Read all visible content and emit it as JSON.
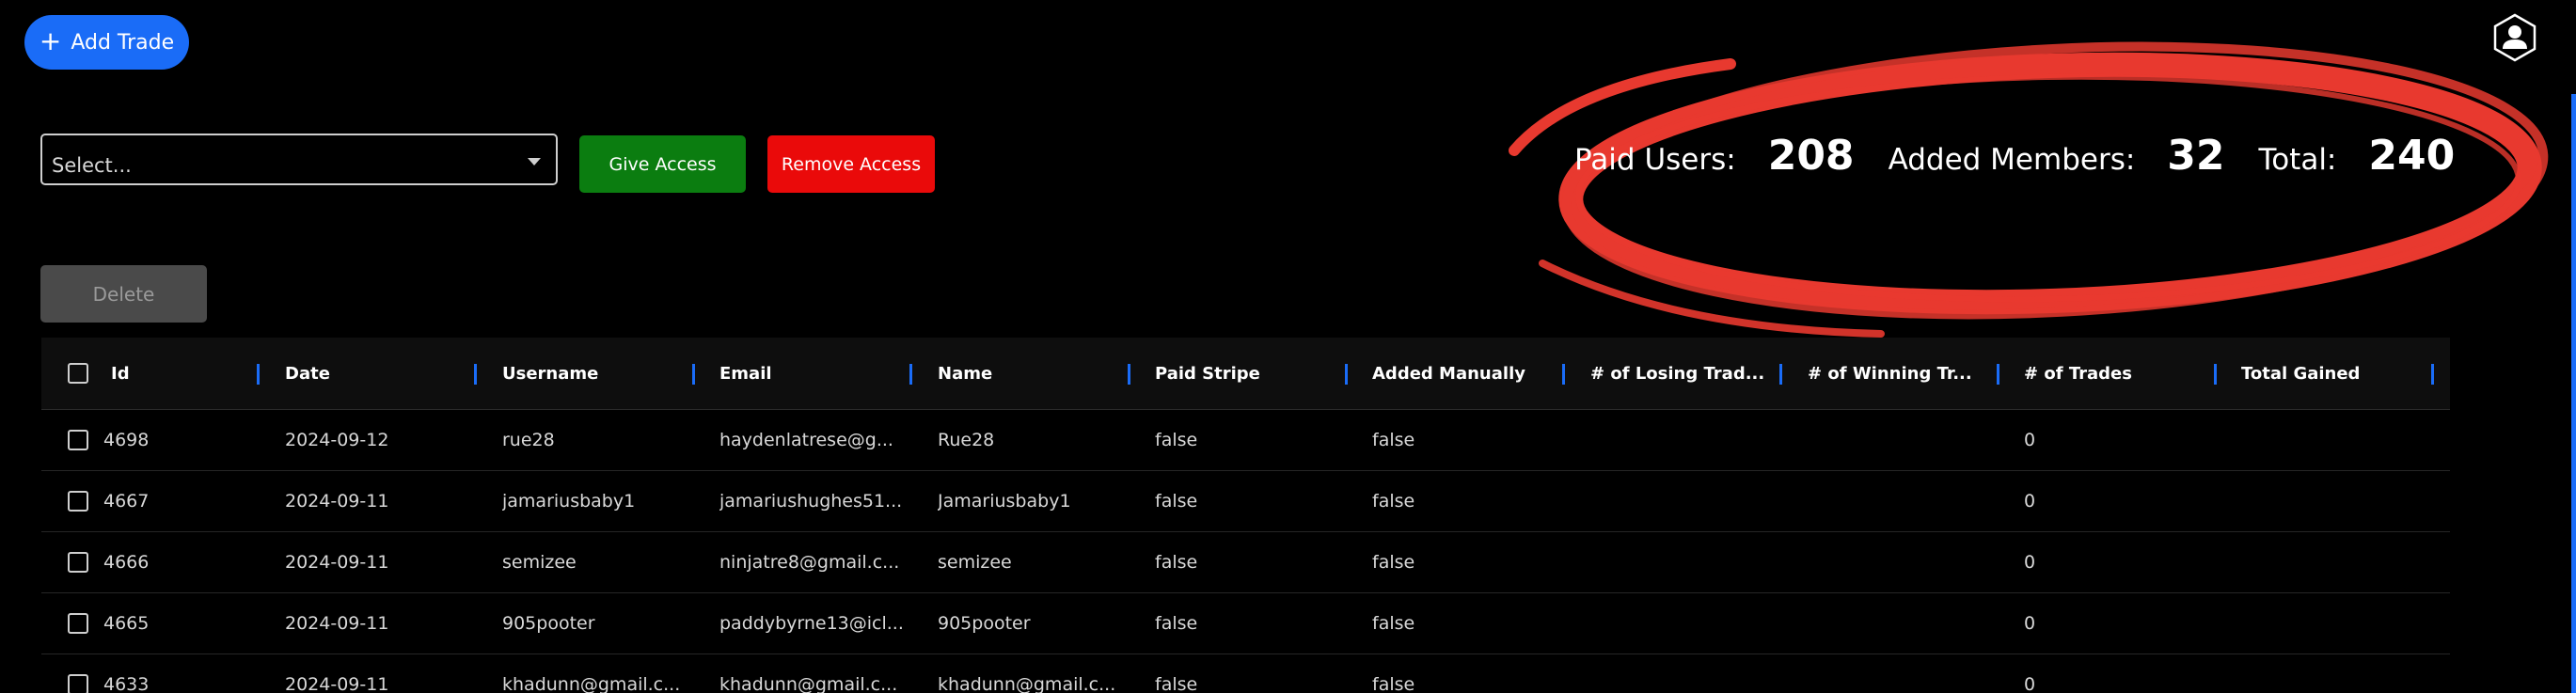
{
  "toolbar": {
    "add_trade_label": "Add Trade",
    "add_icon": "plus-icon"
  },
  "access": {
    "select_placeholder": "Select...",
    "give_access_label": "Give Access",
    "remove_access_label": "Remove Access"
  },
  "stats": {
    "paid_users_label": "Paid Users:",
    "paid_users_value": "208",
    "added_members_label": "Added Members:",
    "added_members_value": "32",
    "total_label": "Total:",
    "total_value": "240",
    "highlight_color": "#e8392f"
  },
  "delete_label": "Delete",
  "table": {
    "columns": [
      "Id",
      "Date",
      "Username",
      "Email",
      "Name",
      "Paid Stripe",
      "Added Manually",
      "# of Losing Trad...",
      "# of Winning Tr...",
      "# of Trades",
      "Total Gained"
    ],
    "rows": [
      [
        "4698",
        "2024-09-12",
        "rue28",
        "haydenlatrese@g...",
        "Rue28",
        "false",
        "false",
        "",
        "",
        "0",
        ""
      ],
      [
        "4667",
        "2024-09-11",
        "jamariusbaby1",
        "jamariushughes51...",
        "Jamariusbaby1",
        "false",
        "false",
        "",
        "",
        "0",
        ""
      ],
      [
        "4666",
        "2024-09-11",
        "semizee",
        "ninjatre8@gmail.c...",
        "semizee",
        "false",
        "false",
        "",
        "",
        "0",
        ""
      ],
      [
        "4665",
        "2024-09-11",
        "905pooter",
        "paddybyrne13@icl...",
        "905pooter",
        "false",
        "false",
        "",
        "",
        "0",
        ""
      ],
      [
        "4633",
        "2024-09-11",
        "khadunn@gmail.c...",
        "khadunn@gmail.c...",
        "khadunn@gmail.c...",
        "false",
        "false",
        "",
        "",
        "0",
        ""
      ]
    ]
  },
  "colors": {
    "accent": "#1a6cf7",
    "give": "#0b7d10",
    "remove": "#ea0a0a"
  }
}
